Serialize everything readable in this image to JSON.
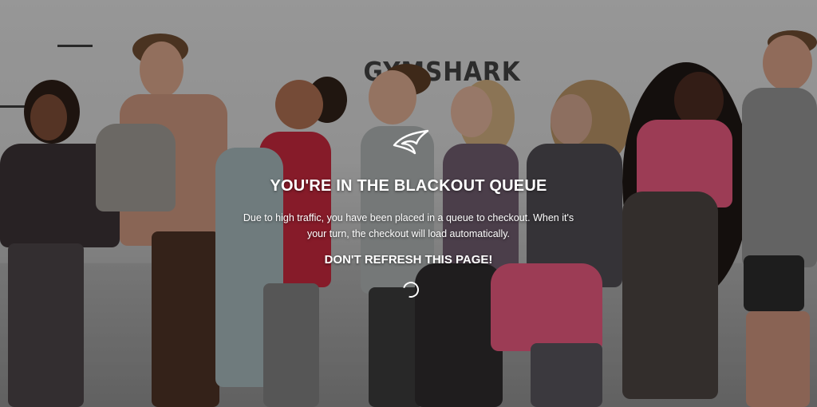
{
  "background": {
    "brand_wordmark": "GYMSHARK"
  },
  "queue": {
    "logo_icon": "gymshark-shark-icon",
    "title": "YOU'RE IN THE BLACKOUT QUEUE",
    "message": "Due to high traffic, you have been placed in a queue to checkout. When it's your turn, the checkout will load automatically.",
    "warning": "DON'T REFRESH THIS PAGE!",
    "spinner_icon": "loading-spinner-icon"
  },
  "colors": {
    "text": "#ffffff",
    "overlay": "rgba(0,0,0,0.30)",
    "pink_top": "#e0567a",
    "red_top": "#c0283c"
  }
}
